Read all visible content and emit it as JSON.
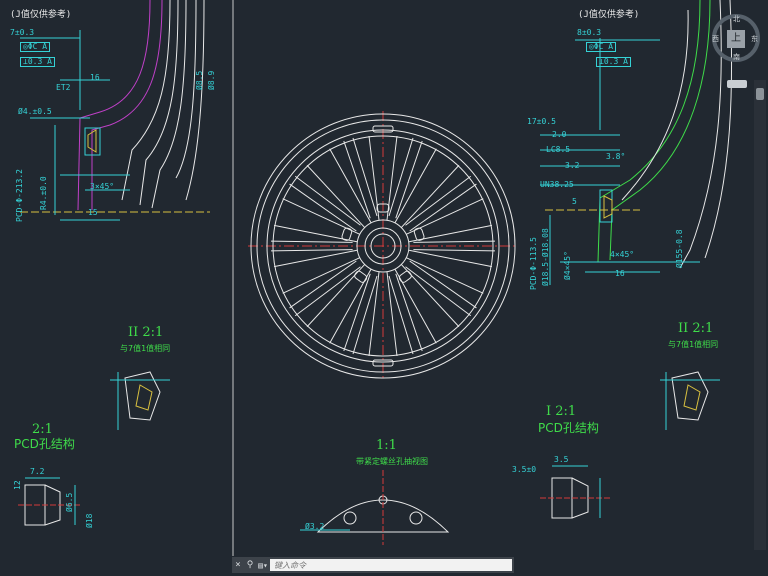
{
  "cad": {
    "left_view": {
      "note": "(J值仅供参考)",
      "dim_top": "7±0.3",
      "fcf1": "◎ΦC A",
      "fcf2": "⊥0.3 A",
      "dim_16": "16",
      "et": "ET2",
      "dia_h1": "Ø8.5",
      "dia_h2": "Ø8.9",
      "dim_hole": "Ø4.±0.5",
      "chamfer": "3×45°",
      "dim_15": "15",
      "pcd": "PCD-Φ-213.2",
      "r4": "R4.±0.0"
    },
    "right_view": {
      "note": "(J值仅供参考)",
      "dim_top": "8±0.3",
      "fcf1": "◎ΦC A",
      "fcf2": "⊥0.3 A",
      "d17": "17±0.5",
      "d20": "2.0",
      "lc": "LC8.5",
      "d38": "3.8°",
      "d32": "3.2",
      "un": "UN38.25",
      "d5": "5",
      "chamfer": "4×45°",
      "dia_155": "Ø155-0.8",
      "d16": "16",
      "pcd1": "PCD-Φ-113.5",
      "pcd2": "Ø18.5-Ø18.08",
      "dia_4": "Ø4×45°"
    },
    "details": {
      "II_left_title": "II 2:1",
      "II_left_sub": "与7值1值相同",
      "II_right_title": "II 2:1",
      "II_right_sub": "与7值1值相同",
      "pcd_left_scale": "2:1",
      "pcd_left_title": "PCD孔结构",
      "I_right_scale": "I 2:1",
      "I_right_title": "PCD孔结构",
      "center_scale": "1:1",
      "center_title": "带紧定螺丝孔抽视图",
      "center_dim": "Ø3.2",
      "d72": "7.2",
      "d35": "3.5±0",
      "d12": "12",
      "d18": "Ø18",
      "d65": "Ø6.5",
      "d35b": "3.5"
    }
  },
  "viewcube": {
    "top": "北",
    "right": "东",
    "left": "西",
    "bottom": "南",
    "face": "上",
    "wcs": "WCS"
  },
  "command": {
    "placeholder": "键入命令",
    "close_icon": "×",
    "custom_icon": "⚲",
    "recent_icon": "▤▾"
  },
  "colors": {
    "background": "#212830",
    "drawing_white": "#e8e8e8",
    "dimension_cyan": "#35d2d6",
    "title_green": "#3fdc4a",
    "centerline_red": "#d23a3a",
    "magenta": "#c040c8"
  }
}
